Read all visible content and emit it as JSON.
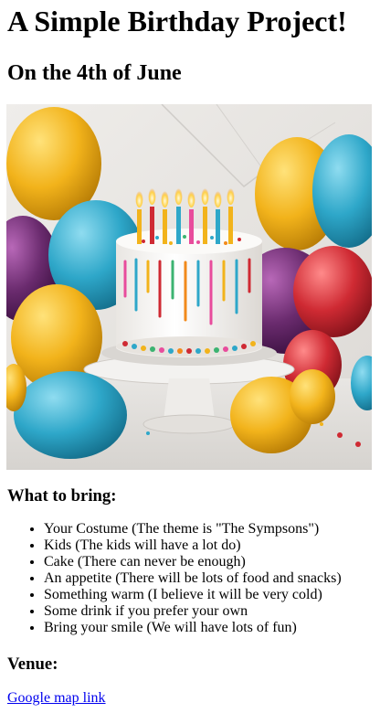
{
  "header": {
    "title": "A Simple Birthday Project!",
    "date": "On the 4th of June"
  },
  "hero_image": {
    "icon": "birthday-cake-with-balloons"
  },
  "bring": {
    "heading": "What to bring:",
    "items": [
      "Your Costume (The theme is \"The Sympsons\")",
      "Kids (The kids will have a lot do)",
      "Cake (There can never be enough)",
      "An appetite (There will be lots of food and snacks)",
      "Something warm (I believe it will be very cold)",
      "Some drink if you prefer your own",
      "Bring your smile (We will have lots of fun)"
    ]
  },
  "venue": {
    "heading": "Venue:",
    "link_label": "Google map link"
  },
  "colors": {
    "link": "#0000ee",
    "balloon_yellow": "#f2b31b",
    "balloon_blue": "#2ea7c9",
    "balloon_purple": "#6a2b6e",
    "balloon_red": "#cf2a33",
    "backdrop": "#e9e7e4"
  }
}
